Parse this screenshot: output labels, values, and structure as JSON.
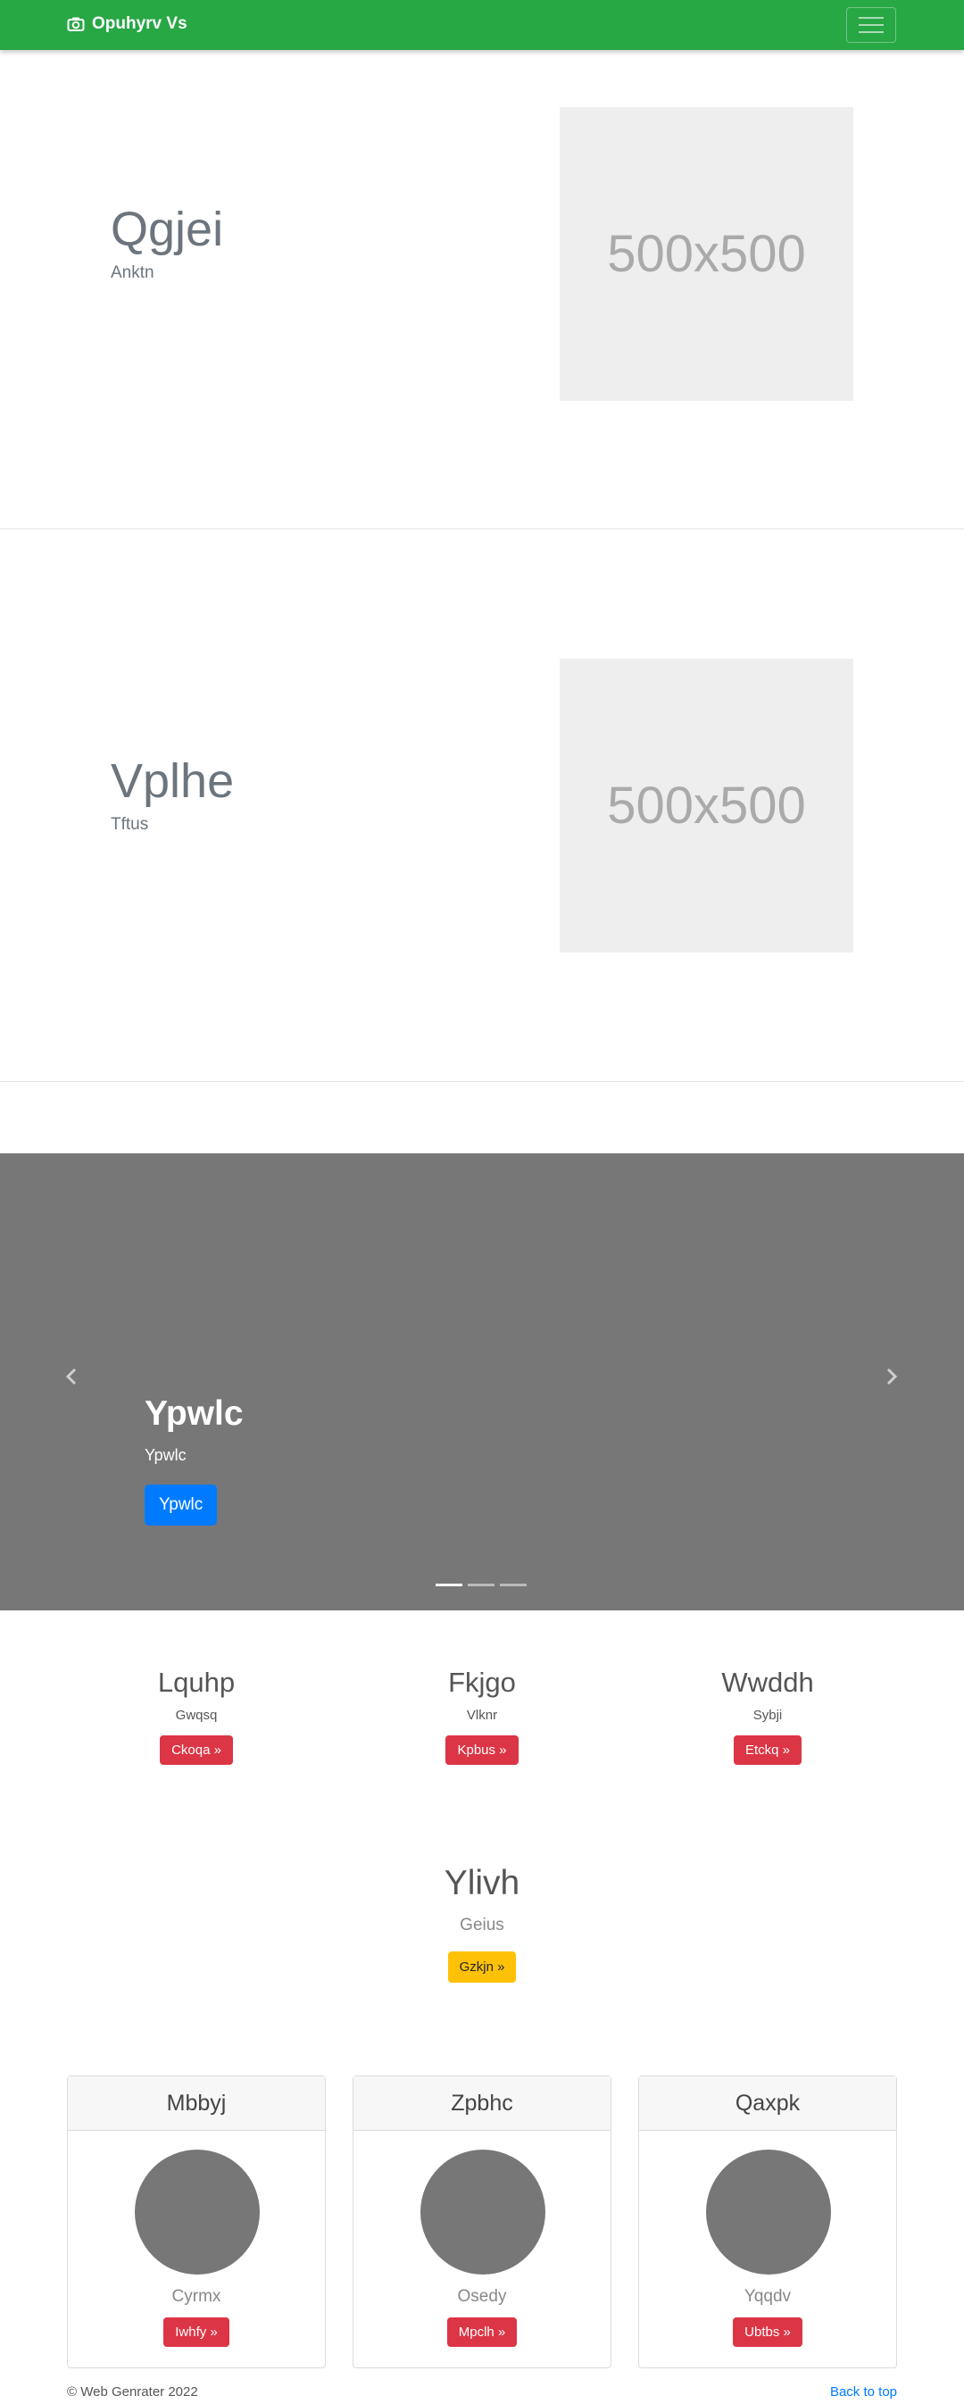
{
  "navbar": {
    "brand": "Opuhyrv Vs",
    "brand_icon": "camera-icon",
    "bg_color": "#28a745"
  },
  "featurettes": [
    {
      "heading": "Qgjei",
      "subtext": "Anktn",
      "image_label": "500x500"
    },
    {
      "heading": "Vplhe",
      "subtext": "Tftus",
      "image_label": "500x500"
    }
  ],
  "carousel": {
    "title": "Ypwlc",
    "subtitle": "Ypwlc",
    "button": "Ypwlc",
    "prev_icon": "chevron-left-icon",
    "next_icon": "chevron-right-icon",
    "slide_count": 3,
    "active_index": 0
  },
  "columns": [
    {
      "heading": "Lquhp",
      "subtext": "Gwqsq",
      "button": "Ckoqa »"
    },
    {
      "heading": "Fkjgo",
      "subtext": "Vlknr",
      "button": "Kpbus »"
    },
    {
      "heading": "Wwddh",
      "subtext": "Sybji",
      "button": "Etckq »"
    }
  ],
  "center_block": {
    "heading": "Ylivh",
    "subtext": "Geius",
    "button": "Gzkjn »"
  },
  "cards": [
    {
      "header": "Mbbyj",
      "name": "Cyrmx",
      "button": "Iwhfy »"
    },
    {
      "header": "Zpbhc",
      "name": "Osedy",
      "button": "Mpclh »"
    },
    {
      "header": "Qaxpk",
      "name": "Yqqdv",
      "button": "Ubtbs »"
    }
  ],
  "footer": {
    "copyright": "© Web Genrater 2022",
    "back_to_top": "Back to top"
  }
}
